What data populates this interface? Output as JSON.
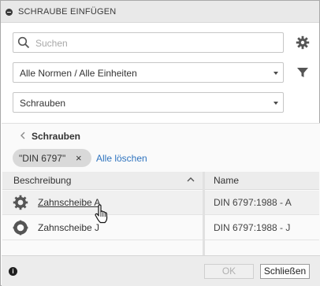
{
  "dialog": {
    "title": "SCHRAUBE EINFÜGEN"
  },
  "search": {
    "placeholder": "Suchen"
  },
  "filters": {
    "standard_select_value": "Alle Normen / Alle Einheiten",
    "category_select_value": "Schrauben"
  },
  "breadcrumb": {
    "label": "Schrauben"
  },
  "active_filter": {
    "chip_label": "\"DIN 6797\"",
    "chip_remove": "×",
    "clear_all_label": "Alle löschen"
  },
  "table": {
    "columns": [
      "Beschreibung",
      "Name"
    ],
    "rows": [
      {
        "description": "Zahnscheibe A",
        "name": "DIN 6797:1988 - A"
      },
      {
        "description": "Zahnscheibe J",
        "name": "DIN 6797:1988 - J"
      }
    ]
  },
  "footer": {
    "info_glyph": "i",
    "ok_label": "OK",
    "close_label": "Schließen"
  },
  "colors": {
    "link": "#2f74bf",
    "titlebar": "#e9e9e9",
    "chip": "#d9d9d9"
  },
  "icons": {
    "title": "collapse-icon",
    "search": "search-icon",
    "settings": "gear-icon",
    "filter": "funnel-icon",
    "back": "chevron-left-icon",
    "sort": "chevron-up-icon",
    "row1": "serrated-washer-icon",
    "row2": "lock-washer-icon",
    "footer": "info-icon"
  }
}
